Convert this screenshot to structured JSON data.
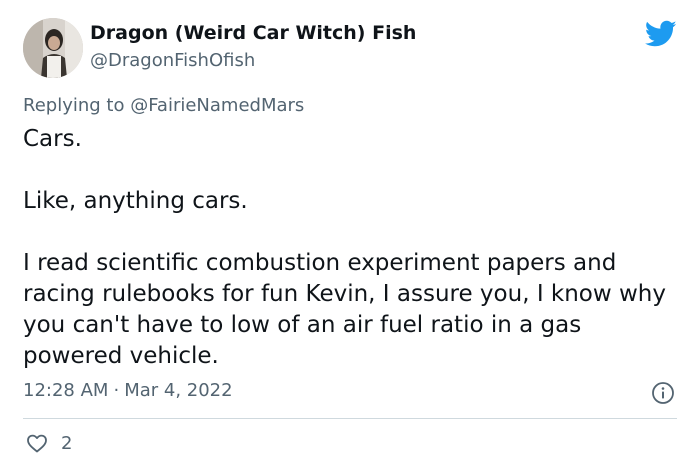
{
  "tweet": {
    "author": {
      "display_name": "Dragon (Weird Car Witch) Fish",
      "handle": "@DragonFishOfish",
      "avatar_icon": "profile-photo"
    },
    "platform_icon": "twitter-bird-icon",
    "brand_color": "#1d9bf0",
    "replying_to": {
      "prefix": "Replying to",
      "mention": "@FairieNamedMars"
    },
    "body": {
      "paragraph_1": "Cars.",
      "paragraph_2": "Like, anything cars.",
      "paragraph_3": "I read scientific combustion experiment papers and racing rulebooks for fun Kevin, I assure you, I know why you can't have to low of an air fuel ratio in a gas powered vehicle."
    },
    "meta": {
      "time": "12:28 AM",
      "separator": "·",
      "date": "Mar 4, 2022"
    },
    "info_icon": "info-circle-icon",
    "actions": {
      "like_icon": "heart-icon",
      "like_count": "2"
    }
  }
}
